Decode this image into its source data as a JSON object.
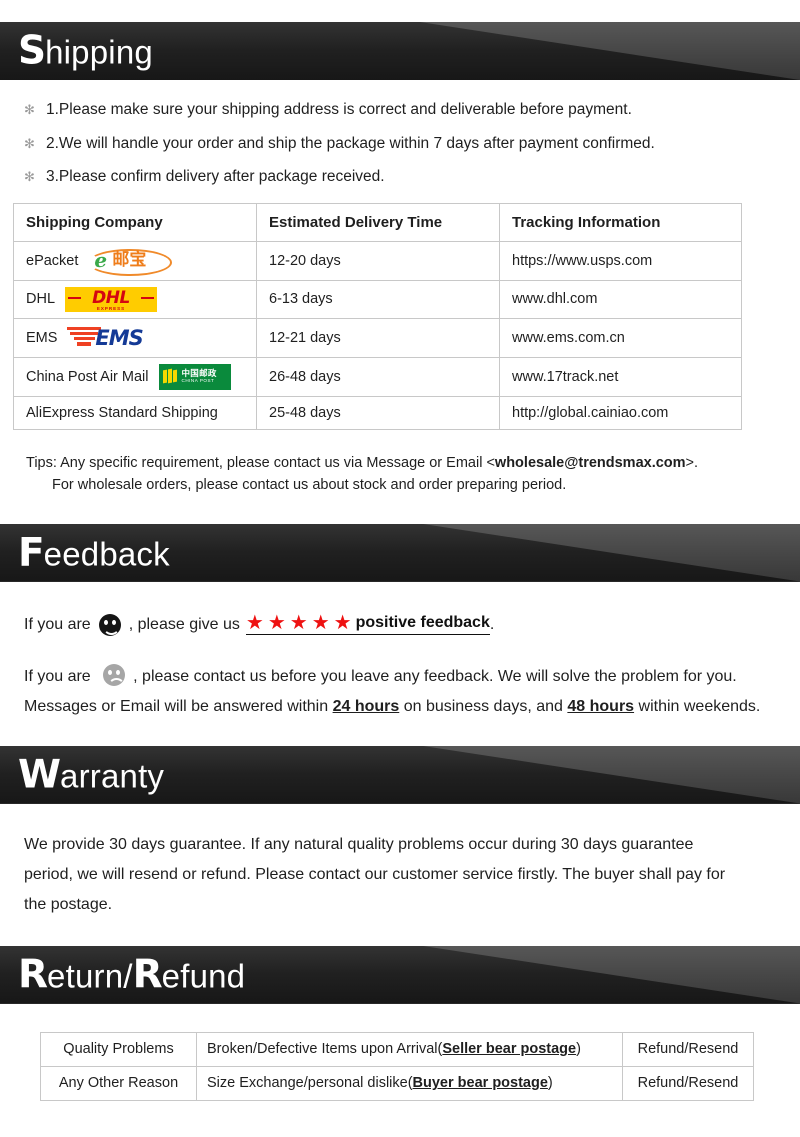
{
  "sections": {
    "shipping": {
      "cap": "S",
      "rest": "hipping",
      "bullet_glyph": "✻",
      "bullets": [
        "1.Please make sure your shipping address is correct and deliverable before payment.",
        "2.We will handle your order and ship the package within    7 days after payment confirmed.",
        "3.Please confirm delivery after package received."
      ],
      "table": {
        "headers": [
          "Shipping Company",
          "Estimated Delivery Time",
          "Tracking Information"
        ],
        "rows": [
          {
            "company": "ePacket",
            "logo": "epacket-logo",
            "time": "12-20 days",
            "tracking": "https://www.usps.com"
          },
          {
            "company": "DHL",
            "logo": "dhl-logo",
            "time": "6-13 days",
            "tracking": "www.dhl.com"
          },
          {
            "company": "EMS",
            "logo": "ems-logo",
            "time": "12-21 days",
            "tracking": "www.ems.com.cn"
          },
          {
            "company": "China Post Air Mail",
            "logo": "china-post-logo",
            "time": "26-48 days",
            "tracking": "www.17track.net"
          },
          {
            "company": "AliExpress Standard Shipping",
            "logo": "",
            "time": "25-48 days",
            "tracking": "http://global.cainiao.com"
          }
        ]
      },
      "tips": {
        "line1_pre": "Tips: Any specific requirement, please contact us via Message or Email <",
        "line1_email": "wholesale@trendsmax.com",
        "line1_post": ">.",
        "line2": "For wholesale orders, please contact us about stock and order preparing period."
      }
    },
    "feedback": {
      "cap": "F",
      "rest": "eedback",
      "line1_pre": "If you are",
      "line1_mid": ", please give us",
      "stars": "★★★★★",
      "star_count": 5,
      "positive_label": "positive feedback",
      "line1_end": ".",
      "line2_pre": "If you are",
      "line2_post": ", please contact us before you leave any feedback. We will solve the problem for you.",
      "line3_pre": "Messages or Email will be answered within ",
      "line3_b1": "24 hours",
      "line3_mid": " on business days, and ",
      "line3_b2": "48 hours",
      "line3_end": " within weekends."
    },
    "warranty": {
      "cap": "W",
      "rest": "arranty",
      "text": "We provide 30 days guarantee. If any natural quality problems occur during 30 days guarantee period, we will resend or refund. Please contact our customer service firstly. The buyer shall pay for the postage."
    },
    "return_refund": {
      "cap1": "R",
      "mid": "eturn/",
      "cap2": "R",
      "rest": "efund",
      "table": {
        "rows": [
          {
            "reason": "Quality Problems",
            "desc_pre": "Broken/Defective Items upon  Arrival(",
            "desc_bold": "Seller bear postage",
            "desc_post": ")",
            "action": "Refund/Resend"
          },
          {
            "reason": "Any Other Reason",
            "desc_pre": "Size Exchange/personal dislike(",
            "desc_bold": "Buyer bear postage",
            "desc_post": ")",
            "action": "Refund/Resend"
          }
        ]
      }
    }
  },
  "colors": {
    "banner_dark": "#1c1c1c",
    "banner_light": "#444444",
    "star_red": "#ee1111",
    "dhl_yellow": "#ffcc00",
    "dhl_red": "#d40511",
    "ems_blue": "#143a96",
    "ems_red": "#ef4123",
    "china_post_green": "#0a8a3c",
    "epacket_orange": "#ef7d1a"
  }
}
